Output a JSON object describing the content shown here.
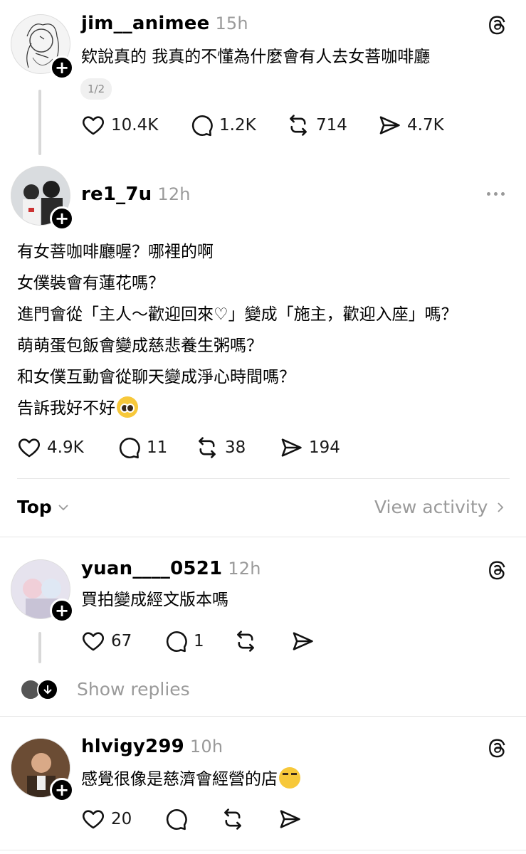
{
  "posts": [
    {
      "username": "jim__animee",
      "time": "15h",
      "lines": [
        "欸說真的 我真的不懂為什麼會有人去女菩咖啡廳"
      ],
      "page_indicator": "1/2",
      "likes": "10.4K",
      "comments": "1.2K",
      "reposts": "714",
      "shares": "4.7K"
    },
    {
      "username": "re1_7u",
      "time": "12h",
      "lines": [
        "有女菩咖啡廳喔？哪裡的啊",
        "女僕裝會有蓮花嗎？",
        "進門會從「主人～歡迎回來♡」變成「施主，歡迎入座」嗎？",
        "萌萌蛋包飯會變成慈悲養生粥嗎？",
        "和女僕互動會從聊天變成淨心時間嗎？",
        "告訴我好不好"
      ],
      "likes": "4.9K",
      "comments": "11",
      "reposts": "38",
      "shares": "194"
    }
  ],
  "sort_bar": {
    "sort_label": "Top",
    "view_activity": "View activity"
  },
  "replies": [
    {
      "username": "yuan____0521",
      "time": "12h",
      "text": "買拍變成經文版本嗎",
      "likes": "67",
      "comments": "1",
      "show_replies": "Show replies"
    },
    {
      "username": "hlvigy299",
      "time": "10h",
      "text": "感覺很像是慈濟會經營的店",
      "likes": "20"
    }
  ],
  "icons": {
    "like": "heart-icon",
    "comment": "comment-icon",
    "repost": "repost-icon",
    "share": "share-icon",
    "threads": "threads-logo-icon",
    "more": "more-icon",
    "chevron": "chevron-icon",
    "emoji_pleading": "pleading-face-emoji",
    "emoji_laugh": "rofl-emoji"
  }
}
